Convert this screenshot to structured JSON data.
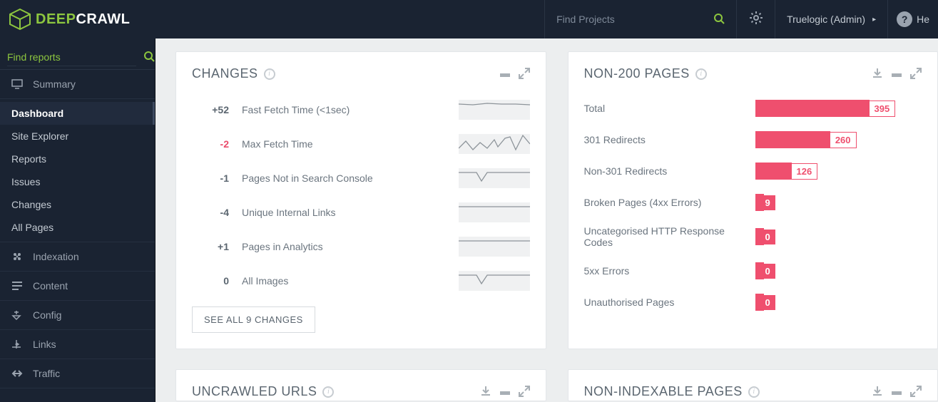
{
  "brand": {
    "deep": "DEEP",
    "crawl": "CRAWL"
  },
  "topbar": {
    "find_projects_placeholder": "Find Projects",
    "user_label": "Truelogic (Admin)",
    "help_label": "He"
  },
  "sidebar": {
    "find_reports_placeholder": "Find reports",
    "summary_label": "Summary",
    "subs": [
      {
        "label": "Dashboard",
        "active": true
      },
      {
        "label": "Site Explorer",
        "active": false
      },
      {
        "label": "Reports",
        "active": false
      },
      {
        "label": "Issues",
        "active": false
      },
      {
        "label": "Changes",
        "active": false
      },
      {
        "label": "All Pages",
        "active": false
      }
    ],
    "sections": [
      {
        "label": "Indexation",
        "icon": "indexation-icon"
      },
      {
        "label": "Content",
        "icon": "content-icon"
      },
      {
        "label": "Config",
        "icon": "config-icon"
      },
      {
        "label": "Links",
        "icon": "links-icon"
      },
      {
        "label": "Traffic",
        "icon": "traffic-icon"
      }
    ]
  },
  "cards": {
    "changes": {
      "title": "CHANGES",
      "rows": [
        {
          "delta": "+52",
          "neg": false,
          "label": "Fast Fetch Time (<1sec)"
        },
        {
          "delta": "-2",
          "neg": true,
          "label": "Max Fetch Time"
        },
        {
          "delta": "-1",
          "neg": false,
          "label": "Pages Not in Search Console"
        },
        {
          "delta": "-4",
          "neg": false,
          "label": "Unique Internal Links"
        },
        {
          "delta": "+1",
          "neg": false,
          "label": "Pages in Analytics"
        },
        {
          "delta": "0",
          "neg": false,
          "label": "All Images"
        }
      ],
      "see_all": "SEE ALL 9 CHANGES"
    },
    "non200": {
      "title": "NON-200 PAGES",
      "max": 395,
      "rows": [
        {
          "label": "Total",
          "value": 395
        },
        {
          "label": "301 Redirects",
          "value": 260
        },
        {
          "label": "Non-301 Redirects",
          "value": 126
        },
        {
          "label": "Broken Pages (4xx Errors)",
          "value": 9
        },
        {
          "label": "Uncategorised HTTP Response Codes",
          "value": 0
        },
        {
          "label": "5xx Errors",
          "value": 0
        },
        {
          "label": "Unauthorised Pages",
          "value": 0
        }
      ]
    },
    "uncrawled": {
      "title": "UNCRAWLED URLS"
    },
    "nonindexable": {
      "title": "NON-INDEXABLE PAGES"
    }
  },
  "chart_data": {
    "type": "bar",
    "title": "NON-200 PAGES",
    "categories": [
      "Total",
      "301 Redirects",
      "Non-301 Redirects",
      "Broken Pages (4xx Errors)",
      "Uncategorised HTTP Response Codes",
      "5xx Errors",
      "Unauthorised Pages"
    ],
    "values": [
      395,
      260,
      126,
      9,
      0,
      0,
      0
    ],
    "xlabel": "",
    "ylabel": "",
    "ylim": [
      0,
      395
    ]
  }
}
